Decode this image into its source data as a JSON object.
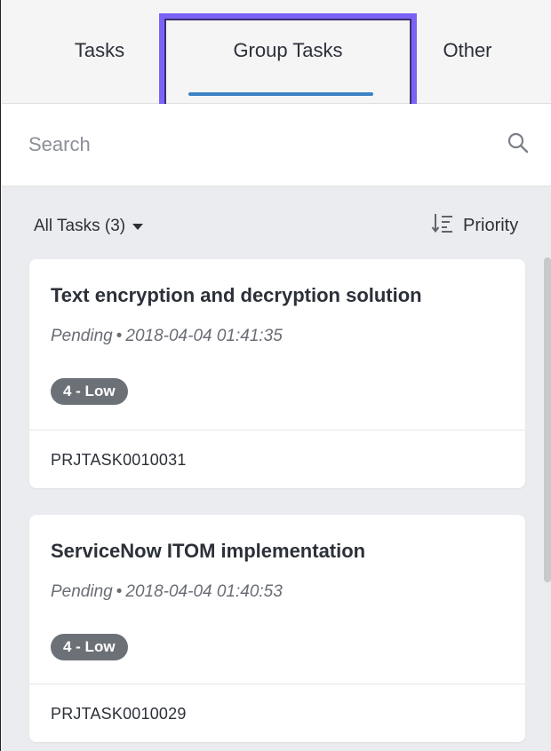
{
  "tabs": [
    {
      "label": "Tasks",
      "selected": false
    },
    {
      "label": "Group Tasks",
      "selected": true
    },
    {
      "label": "Other",
      "selected": false
    }
  ],
  "search": {
    "placeholder": "Search",
    "icon": "search-icon"
  },
  "list_header": {
    "filter_label": "All Tasks (3)",
    "filter_icon": "caret-down-icon",
    "sort_label": "Priority",
    "sort_icon": "sort-descending-icon"
  },
  "cards": [
    {
      "title": "Text encryption and decryption solution",
      "status": "Pending",
      "separator": "•",
      "timestamp": "2018-04-04 01:41:35",
      "priority": "4 - Low",
      "number": "PRJTASK0010031"
    },
    {
      "title": "ServiceNow ITOM implementation",
      "status": "Pending",
      "separator": "•",
      "timestamp": "2018-04-04 01:40:53",
      "priority": "4 - Low",
      "number": "PRJTASK0010029"
    }
  ],
  "colors": {
    "accent_underline": "#3b82c4",
    "highlight_box": "#7b63f5",
    "badge_bg": "#6c7077",
    "list_bg": "#ebecef"
  }
}
